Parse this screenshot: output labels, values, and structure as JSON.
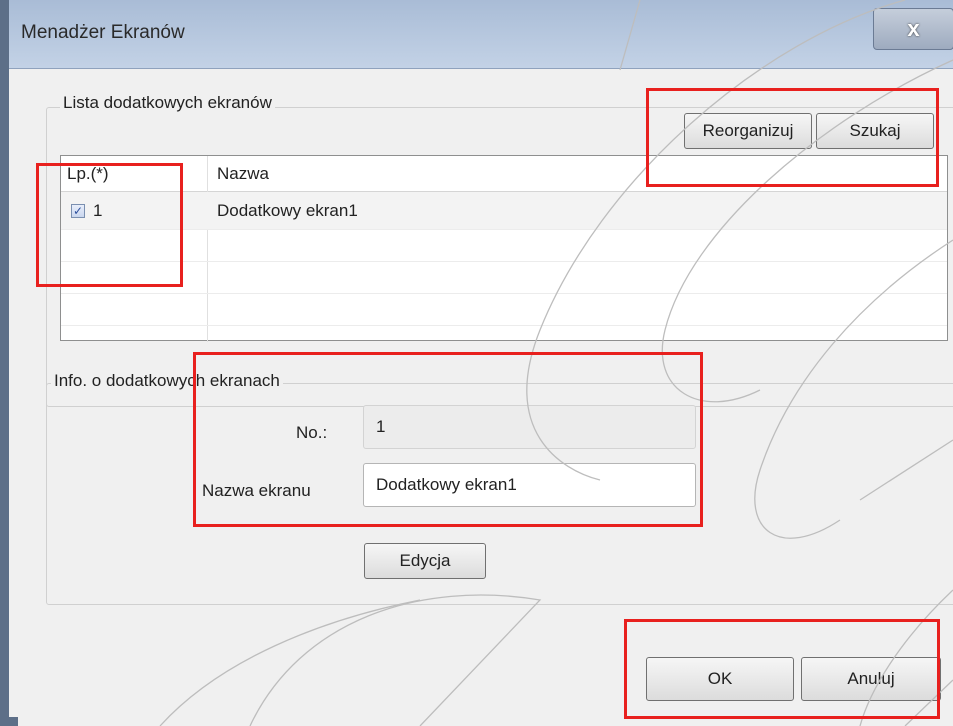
{
  "window": {
    "title": "Menadżer Ekranów",
    "close_glyph": "x"
  },
  "list_group": {
    "label": "Lista dodatkowych ekranów",
    "buttons": {
      "reorganize": "Reorganizuj",
      "search": "Szukaj"
    },
    "columns": [
      "Lp.(*)",
      "Nazwa"
    ],
    "rows": [
      {
        "checked": true,
        "number": "1",
        "name": "Dodatkowy ekran1"
      }
    ]
  },
  "info_group": {
    "label": "Info. o dodatkowych ekranach",
    "no_label": "No.:",
    "no_value": "1",
    "name_label": "Nazwa ekranu",
    "name_value": "Dodatkowy ekran1",
    "edit_button": "Edycja"
  },
  "footer": {
    "ok": "OK",
    "cancel": "Anuluj"
  },
  "highlight_color": "#e8201e"
}
